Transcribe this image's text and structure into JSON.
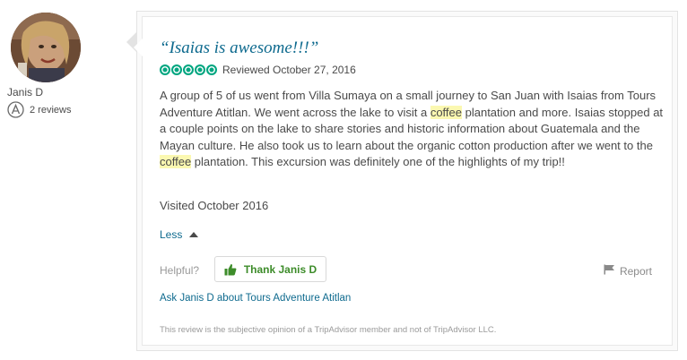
{
  "member": {
    "username": "Janis D",
    "reviews_count": "2 reviews",
    "badge_icon": "reviewer-badge-icon",
    "avatar_icon": "user-avatar"
  },
  "review": {
    "title": "“Isaias is awesome!!!”",
    "rating": 5,
    "rating_max": 5,
    "reviewed_date": "Reviewed October 27, 2016",
    "body_parts": {
      "p1": "A group of 5 of us went from Villa Sumaya on a small journey to San Juan with Isaias from Tours Adventure Atitlan. We went across the lake to visit a ",
      "h1": "coffee",
      "p2": " plantation and more. Isaias stopped at a couple points on the lake to share stories and historic information about Guatemala and the Mayan culture. He also took us to learn about the organic cotton production after we went to the ",
      "h2": "coffee",
      "p3": " plantation. This excursion was definitely one of the highlights of my trip!!"
    },
    "visited": "Visited October 2016",
    "less_label": "Less"
  },
  "actions": {
    "helpful_label": "Helpful?",
    "thank_label": "Thank Janis D",
    "report_label": "Report",
    "ask_label": "Ask Janis D about Tours Adventure Atitlan"
  },
  "disclaimer": "This review is the subjective opinion of a TripAdvisor member and not of TripAdvisor LLC.",
  "colors": {
    "rating_green": "#00a680",
    "link_blue": "#0e6a8e",
    "thank_green": "#3d8c2a",
    "highlight": "#fbf8b1"
  }
}
